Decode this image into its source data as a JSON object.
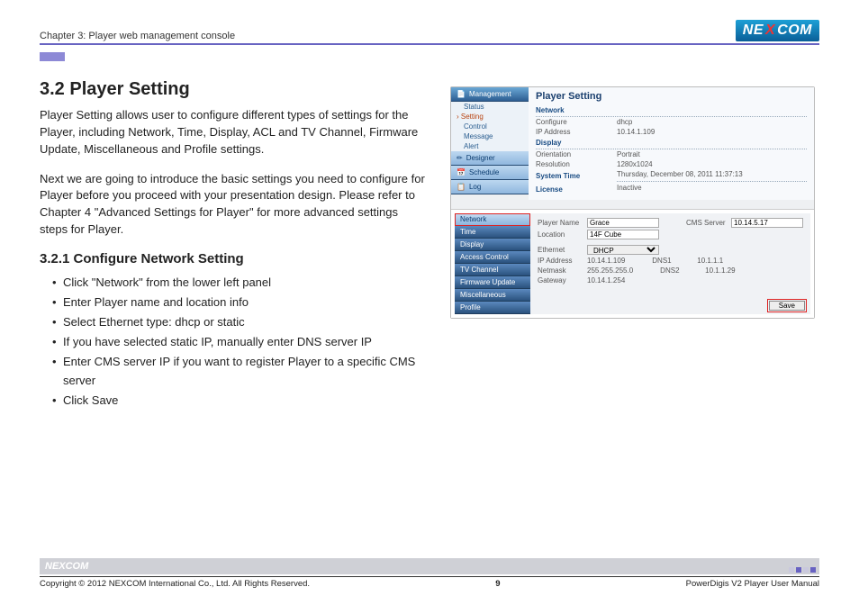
{
  "header": {
    "chapter": "Chapter 3: Player web management console",
    "logo_left": "NE",
    "logo_x": "X",
    "logo_right": "COM"
  },
  "main": {
    "title": "3.2 Player Setting",
    "para1": "Player Setting allows user to configure different types of settings for the Player, including Network, Time, Display, ACL and TV Channel, Firmware Update, Miscellaneous and Profile settings.",
    "para2": "Next we are going to introduce the basic settings you need to configure for Player before you proceed with your presentation design. Please refer to Chapter 4 \"Advanced Settings for Player\" for more advanced settings steps for Player.",
    "subhead": "3.2.1 Configure Network Setting",
    "bullets": [
      "Click \"Network\" from the lower left panel",
      "Enter Player name and location info",
      "Select Ethernet type: dhcp or static",
      "If you have selected static IP, manually enter DNS server IP",
      "Enter CMS server IP if you want to register Player to a specific CMS server",
      "Click Save"
    ]
  },
  "screenshot": {
    "side_main": "Management",
    "side_subs": [
      "Status",
      "Setting",
      "Control",
      "Message",
      "Alert"
    ],
    "side_blocks": [
      "Designer",
      "Schedule",
      "Log"
    ],
    "title": "Player Setting",
    "sections": {
      "network": {
        "head": "Network",
        "rows": [
          [
            "Configure",
            "dhcp"
          ],
          [
            "IP Address",
            "10.14.1.109"
          ]
        ]
      },
      "display": {
        "head": "Display",
        "rows": [
          [
            "Orientation",
            "Portrait"
          ],
          [
            "Resolution",
            "1280x1024"
          ]
        ]
      },
      "systime": {
        "head": "System Time",
        "val": "Thursday, December 08, 2011 11:37:13"
      },
      "license": {
        "head": "License",
        "val": "Inactive"
      }
    },
    "tabs": [
      "Network",
      "Time",
      "Display",
      "Access Control",
      "TV Channel",
      "Firmware Update",
      "Miscellaneous",
      "Profile"
    ],
    "form": {
      "player_name_lbl": "Player Name",
      "player_name": "Grace",
      "location_lbl": "Location",
      "location": "14F Cube",
      "ethernet_lbl": "Ethernet",
      "ethernet": "DHCP",
      "ip_lbl": "IP Address",
      "ip": "10.14.1.109",
      "netmask_lbl": "Netmask",
      "netmask": "255.255.255.0",
      "gateway_lbl": "Gateway",
      "gateway": "10.14.1.254",
      "cms_lbl": "CMS Server",
      "cms": "10.14.5.17",
      "dns1_lbl": "DNS1",
      "dns1": "10.1.1.1",
      "dns2_lbl": "DNS2",
      "dns2": "10.1.1.29",
      "save": "Save"
    }
  },
  "footer": {
    "logo": "NEXCOM",
    "copyright": "Copyright © 2012 NEXCOM International Co., Ltd. All Rights Reserved.",
    "page": "9",
    "manual": "PowerDigis V2 Player User Manual"
  }
}
